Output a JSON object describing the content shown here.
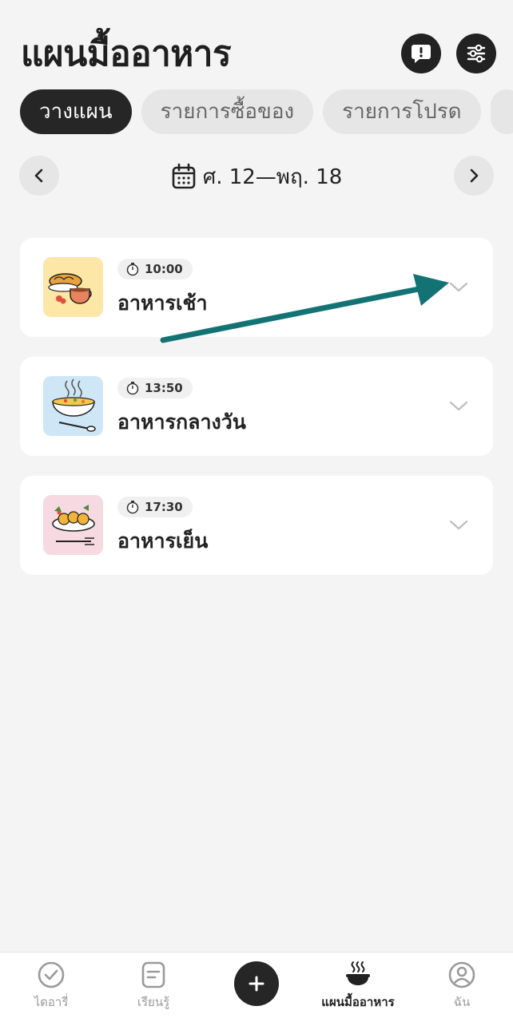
{
  "header": {
    "title": "แผนมื้ออาหาร",
    "feedback_icon": "feedback-icon",
    "filter_icon": "sliders-icon"
  },
  "tabs": [
    {
      "label": "วางแผน",
      "active": true
    },
    {
      "label": "รายการซื้อของ",
      "active": false
    },
    {
      "label": "รายการโปรด",
      "active": false
    }
  ],
  "date_nav": {
    "range": "ศ. 12—พฤ. 18",
    "prev_icon": "chevron-left-icon",
    "next_icon": "chevron-right-icon"
  },
  "meals": [
    {
      "time": "10:00",
      "name": "อาหารเช้า",
      "thumb_bg": "#fde7a6"
    },
    {
      "time": "13:50",
      "name": "อาหารกลางวัน",
      "thumb_bg": "#cfe6f6"
    },
    {
      "time": "17:30",
      "name": "อาหารเย็น",
      "thumb_bg": "#f6d9e1"
    }
  ],
  "annotation": {
    "color": "#137374"
  },
  "bottom_nav": [
    {
      "label": "ไดอารี่",
      "icon": "check-circle-icon",
      "active": false
    },
    {
      "label": "เรียนรู้",
      "icon": "notes-icon",
      "active": false
    },
    {
      "label": "",
      "icon": "plus-icon",
      "active": false
    },
    {
      "label": "แผนมื้ออาหาร",
      "icon": "hot-bowl-icon",
      "active": true
    },
    {
      "label": "ฉัน",
      "icon": "profile-icon",
      "active": false
    }
  ]
}
